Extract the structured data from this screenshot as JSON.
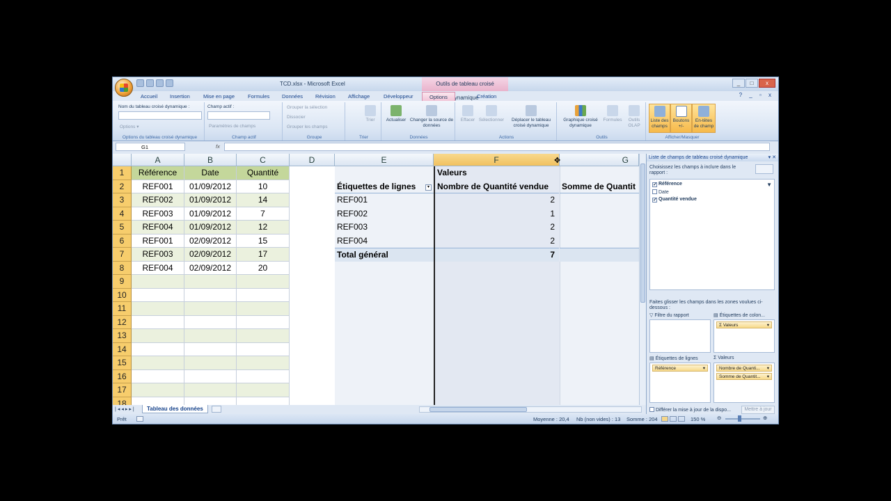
{
  "window": {
    "title": "TCD.xlsx - Microsoft Excel",
    "context_title": "Outils de tableau croisé dynamique",
    "controls": [
      "_",
      "□",
      "x"
    ]
  },
  "tabs": [
    "Accueil",
    "Insertion",
    "Mise en page",
    "Formules",
    "Données",
    "Révision",
    "Affichage",
    "Développeur",
    "Options",
    "Création"
  ],
  "active_tab": "Options",
  "tab_controls": "? _ ▫ x",
  "ribbon": {
    "pt_name_label": "Nom du tableau croisé dynamique :",
    "options_btn": "Options ▾",
    "group1": "Options du tableau croisé dynamique",
    "active_field_label": "Champ actif :",
    "field_settings": "Paramètres de champs",
    "group2": "Champ actif",
    "group_selection": "Grouper la sélection",
    "ungroup": "Dissocier",
    "group_fields": "Grouper les champs",
    "group3": "Groupe",
    "sort": "Trier",
    "group4": "Trier",
    "refresh": "Actualiser",
    "change_source": "Changer la source de données",
    "group5": "Données",
    "clear": "Effacer",
    "select": "Sélectionner",
    "move_pt": "Déplacer le tableau croisé dynamique",
    "group6": "Actions",
    "pivot_chart": "Graphique croisé dynamique",
    "formulas": "Formules",
    "olap": "Outils OLAP",
    "group7": "Outils",
    "field_list": "Liste des champs",
    "buttons": "Boutons +/-",
    "headers": "En-têtes de champ",
    "group8": "Afficher/Masquer"
  },
  "formula_bar": {
    "name_box": "G1",
    "fx": "fx",
    "value": ""
  },
  "columns": [
    "A",
    "B",
    "C",
    "D",
    "E",
    "F",
    "G"
  ],
  "rows": [
    "1",
    "2",
    "3",
    "4",
    "5",
    "6",
    "7",
    "8",
    "9",
    "10",
    "11",
    "12",
    "13",
    "14",
    "15",
    "16",
    "17",
    "18"
  ],
  "source_table": {
    "headers": [
      "Référence",
      "Date",
      "Quantité"
    ],
    "rows": [
      [
        "REF001",
        "01/09/2012",
        "10"
      ],
      [
        "REF002",
        "01/09/2012",
        "14"
      ],
      [
        "REF003",
        "01/09/2012",
        "7"
      ],
      [
        "REF004",
        "01/09/2012",
        "12"
      ],
      [
        "REF001",
        "02/09/2012",
        "15"
      ],
      [
        "REF003",
        "02/09/2012",
        "17"
      ],
      [
        "REF004",
        "02/09/2012",
        "20"
      ]
    ]
  },
  "pivot": {
    "values_label": "Valeurs",
    "row_label": "Étiquettes de lignes",
    "col1": "Nombre de Quantité vendue",
    "col2": "Somme de Quantit",
    "rows": [
      [
        "REF001",
        "2"
      ],
      [
        "REF002",
        "1"
      ],
      [
        "REF003",
        "2"
      ],
      [
        "REF004",
        "2"
      ]
    ],
    "total_label": "Total général",
    "total_value": "7"
  },
  "sheet_tab": "Tableau des données",
  "status": {
    "ready": "Prêt",
    "average": "Moyenne : 20,4",
    "count": "Nb (non vides) : 13",
    "sum": "Somme : 204",
    "zoom": "150 %"
  },
  "field_pane": {
    "title": "Liste de champs de tableau croisé dynamique",
    "choose": "Choisissez les champs à inclure dans le rapport :",
    "fields": [
      {
        "name": "Référence",
        "checked": true
      },
      {
        "name": "Date",
        "checked": false
      },
      {
        "name": "Quantité vendue",
        "checked": true
      }
    ],
    "drag_hint": "Faites glisser les champs dans les zones voulues ci-dessous :",
    "report_filter": "Filtre du rapport",
    "col_labels": "Étiquettes de colon...",
    "col_value_pill": "Σ Valeurs",
    "row_labels": "Étiquettes de lignes",
    "values": "Valeurs",
    "row_pill": "Référence",
    "value_pills": [
      "Nombre de Quanti...",
      "Somme de Quantit..."
    ],
    "defer": "Différer la mise à jour de la dispo...",
    "update": "Mettre à jour"
  }
}
